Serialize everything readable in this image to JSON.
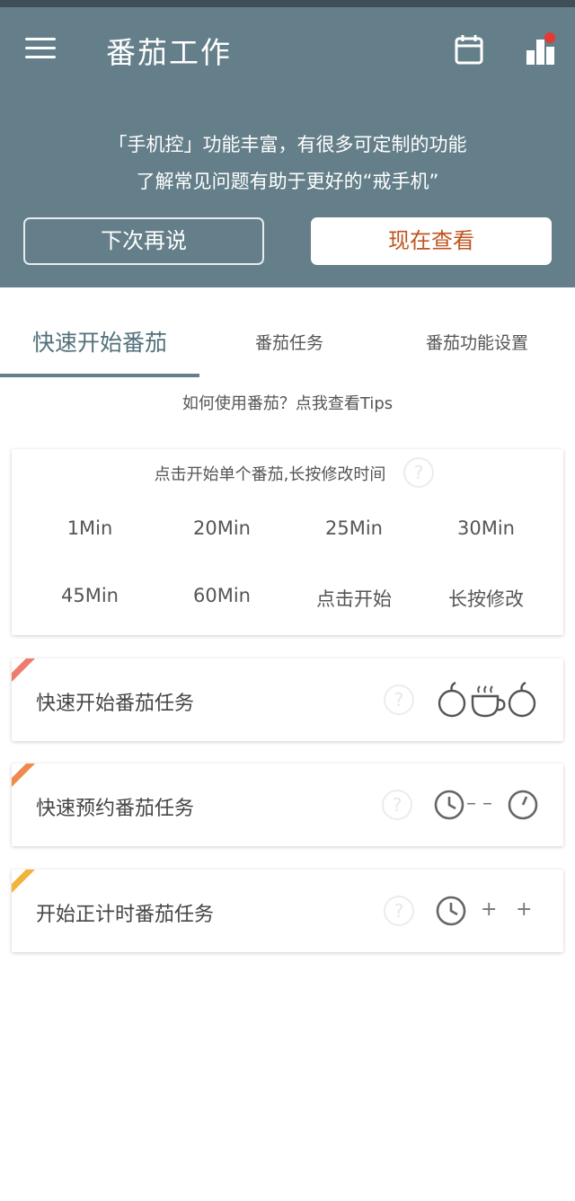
{
  "app_bar": {
    "title": "番茄工作",
    "icons": [
      "menu-icon",
      "calendar-icon",
      "stats-icon"
    ],
    "accent_color": "#647f89",
    "badge_color": "#e53935"
  },
  "banner": {
    "line1": "「手机控」功能丰富，有很多可定制的功能",
    "line2": "了解常见问题有助于更好的“戒手机”",
    "later_label": "下次再说",
    "view_label": "现在查看",
    "view_color": "#c0541f"
  },
  "tabs": [
    {
      "label": "快速开始番茄",
      "active": true
    },
    {
      "label": "番茄任务",
      "active": false
    },
    {
      "label": "番茄功能设置",
      "active": false
    }
  ],
  "tips": "如何使用番茄？点我查看Tips",
  "quick_start": {
    "title": "点击开始单个番茄,长按修改时间",
    "presets": [
      "1Min",
      "20Min",
      "25Min",
      "30Min",
      "45Min",
      "60Min",
      "点击开始",
      "长按修改"
    ]
  },
  "tasks": [
    {
      "label": "快速开始番茄任务",
      "corner_color": "#ef7b6e",
      "graphic": "tomato-cup-tomato"
    },
    {
      "label": "快速预约番茄任务",
      "corner_color": "#ee8a4f",
      "graphic": "clock-dash-clock",
      "symbol": "– –"
    },
    {
      "label": "开始正计时番茄任务",
      "corner_color": "#f1b33b",
      "graphic": "clock-plus-plus",
      "symbols": [
        "+",
        "+"
      ]
    }
  ]
}
